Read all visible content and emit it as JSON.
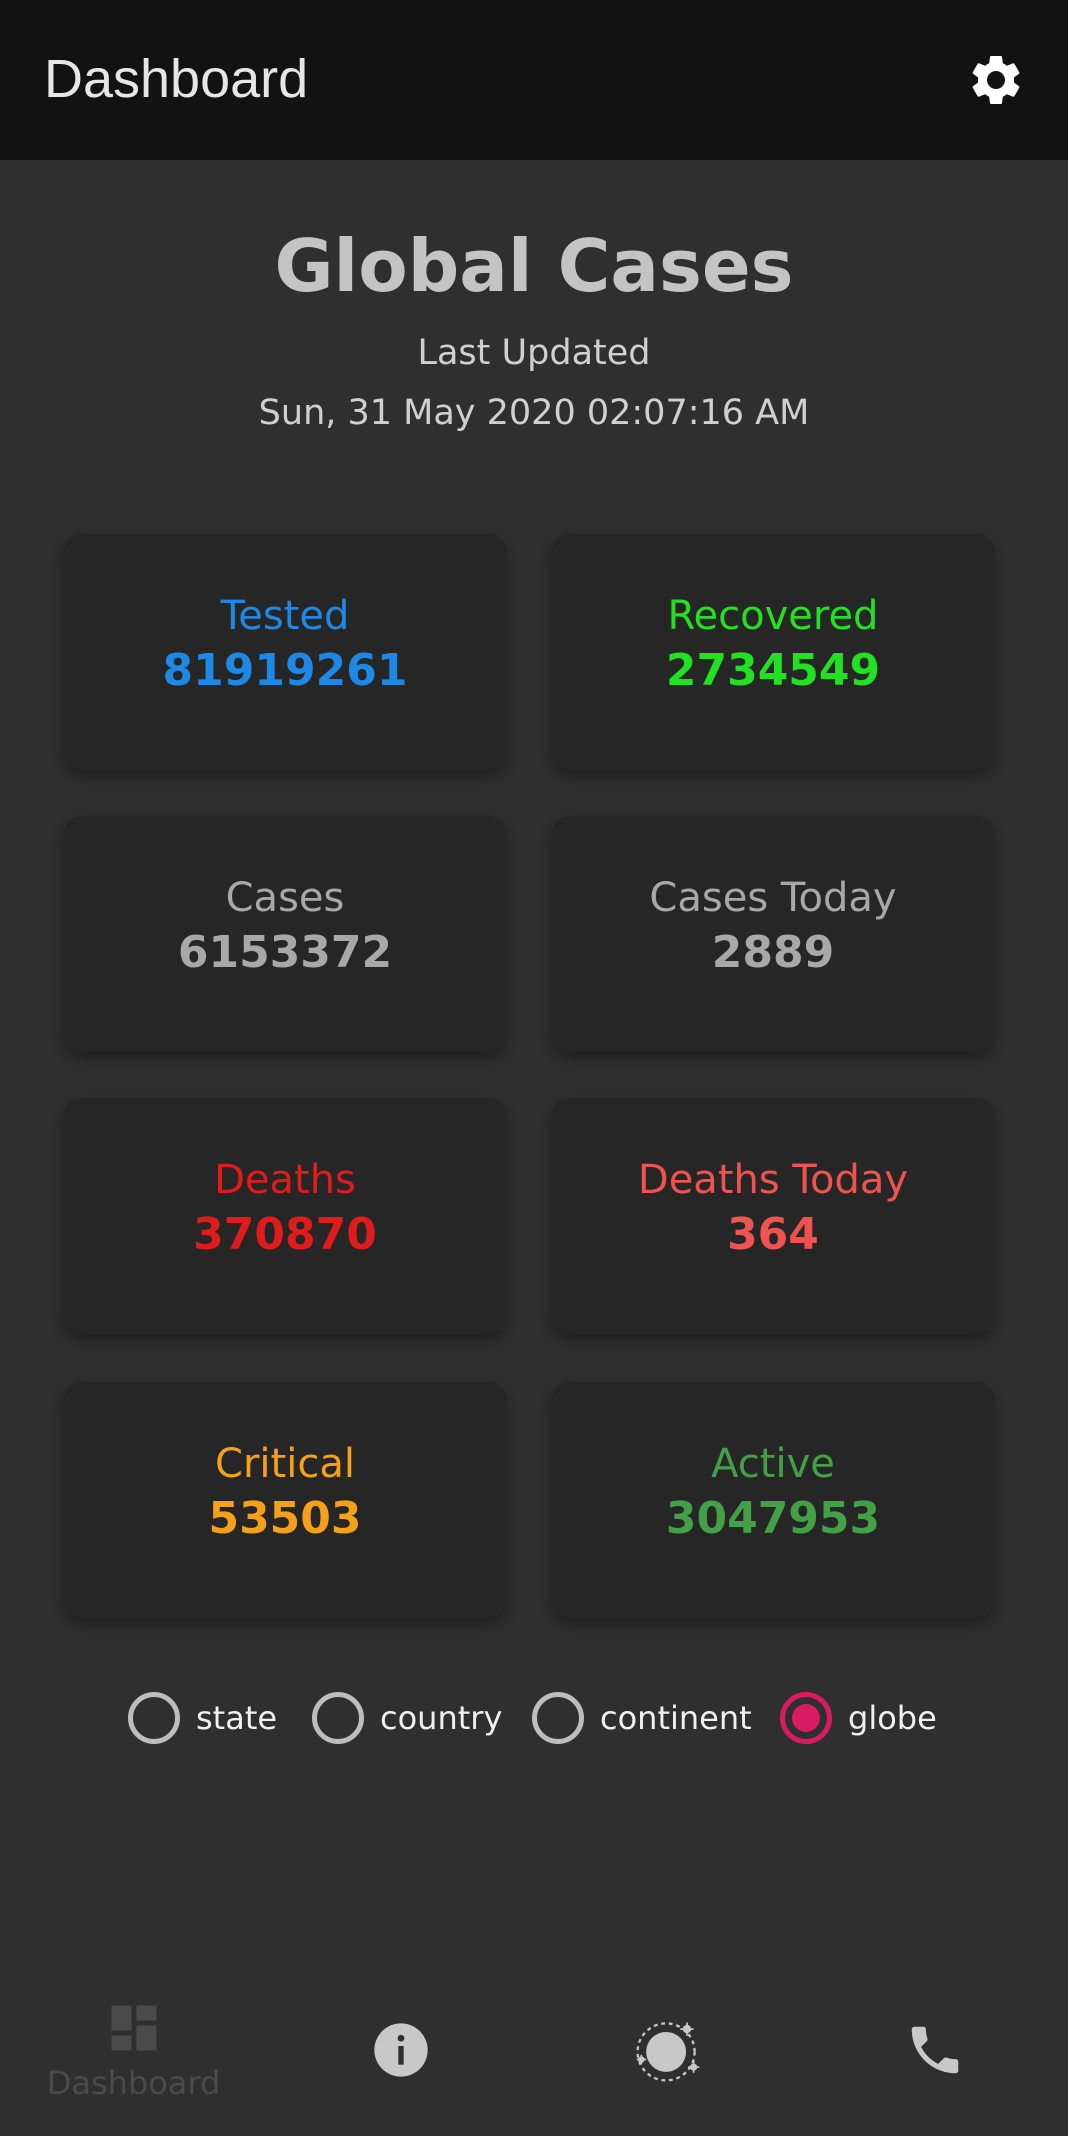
{
  "appbar": {
    "title": "Dashboard",
    "settings_icon": "gear-icon"
  },
  "header": {
    "title": "Global Cases",
    "last_updated_label": "Last Updated",
    "last_updated_value": "Sun, 31 May 2020 02:07:16 AM"
  },
  "stats": [
    {
      "label": "Tested",
      "value": "81919261",
      "color": "#1e88e5"
    },
    {
      "label": "Recovered",
      "value": "2734549",
      "color": "#22e022"
    },
    {
      "label": "Cases",
      "value": "6153372",
      "color": "#a8a8a8"
    },
    {
      "label": "Cases Today",
      "value": "2889",
      "color": "#a8a8a8"
    },
    {
      "label": "Deaths",
      "value": "370870",
      "color": "#e01b1b"
    },
    {
      "label": "Deaths Today",
      "value": "364",
      "color": "#ef5350"
    },
    {
      "label": "Critical",
      "value": "53503",
      "color": "#f5a01a"
    },
    {
      "label": "Active",
      "value": "3047953",
      "color": "#43a047"
    }
  ],
  "scope": {
    "options": [
      "state",
      "country",
      "continent",
      "globe"
    ],
    "selected": "globe"
  },
  "bottom_nav": {
    "items": [
      {
        "icon": "dashboard-icon",
        "label": "Dashboard"
      },
      {
        "icon": "info-icon"
      },
      {
        "icon": "globe-virus-icon"
      },
      {
        "icon": "phone-icon"
      }
    ]
  }
}
